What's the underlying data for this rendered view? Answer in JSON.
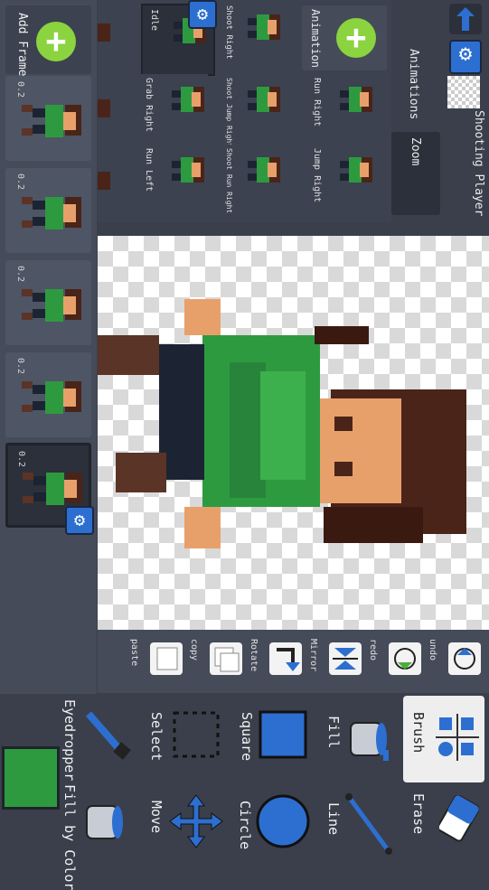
{
  "header": {
    "project_title": "Shooting Player",
    "animations_label": "Animations",
    "zoom_label": "Zoom",
    "upload_icon": "upload-arrow-icon",
    "settings_icon": "gear-icon"
  },
  "animation_panel": {
    "add_label": "Animation",
    "items": [
      {
        "label": "Idle",
        "selected": true
      },
      {
        "label": "Shoot Right",
        "selected": false
      },
      {
        "label": "Run Right",
        "selected": false
      },
      {
        "label": "Grab Right",
        "selected": false
      },
      {
        "label": "Shoot Jump Right",
        "selected": false
      },
      {
        "label": "Run Left",
        "selected": false
      },
      {
        "label": "Shoot Run Right",
        "selected": false
      },
      {
        "label": "Jump Right",
        "selected": false
      }
    ]
  },
  "frames_panel": {
    "add_label": "Add Frame",
    "frames": [
      {
        "duration": "0.2",
        "selected": false
      },
      {
        "duration": "0.2",
        "selected": false
      },
      {
        "duration": "0.2",
        "selected": false
      },
      {
        "duration": "0.2",
        "selected": false
      },
      {
        "duration": "0.2",
        "selected": true
      }
    ]
  },
  "actions": {
    "undo": "undo",
    "redo": "redo",
    "mirror": "Mirror",
    "rotate": "Rotate",
    "copy": "copy",
    "paste": "paste"
  },
  "tools": {
    "brush": "Brush",
    "erase": "Erase",
    "fill": "Fill",
    "line": "Line",
    "square": "Square",
    "circle": "Circle",
    "select": "Select",
    "move": "Move",
    "eyedropper": "Eyedropper",
    "fill_by_color": "Fill by Color",
    "selected_tool": "brush",
    "current_color": "#2e9a40"
  },
  "colors": {
    "panel": "#3a3f4b",
    "accent_blue": "#2d6fd1",
    "add_green": "#8bd33f",
    "character_green": "#2e9a40",
    "skin": "#e8a06a",
    "hair": "#4a2418"
  }
}
